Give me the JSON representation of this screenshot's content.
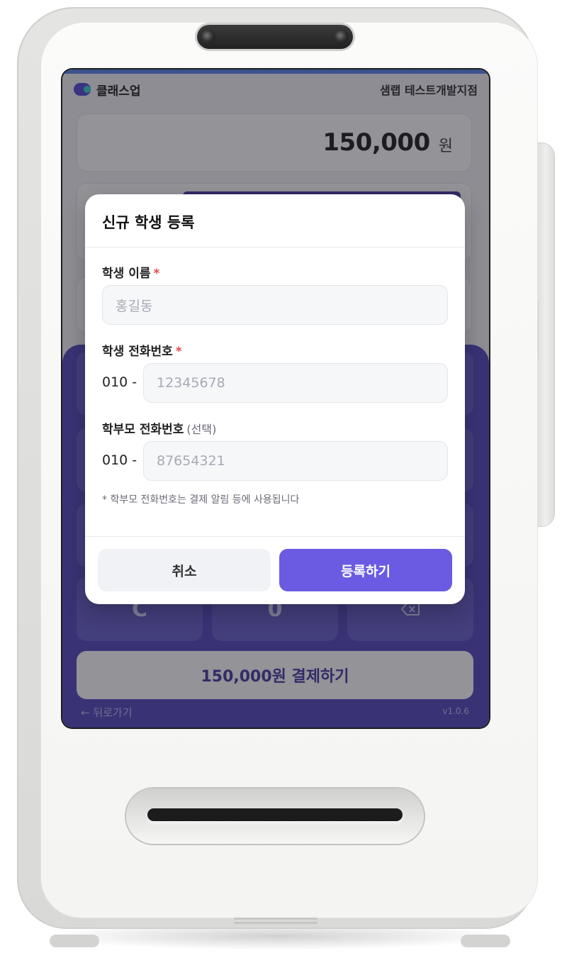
{
  "header": {
    "brand_name": "클래스업",
    "branch_name": "샘랩 테스트개발지점"
  },
  "payment": {
    "amount": "150,000",
    "unit": "원",
    "pay_button_label": "150,000원 결제하기"
  },
  "keypad": {
    "clear_label": "C",
    "zero_label": "0",
    "backspace_icon": "backspace-icon"
  },
  "footer": {
    "back_label": "← 뒤로가기",
    "version": "v1.0.6"
  },
  "modal": {
    "title": "신규 학생 등록",
    "student_name": {
      "label": "학생 이름",
      "required_mark": "*",
      "placeholder": "홍길동"
    },
    "student_phone": {
      "label": "학생 전화번호",
      "required_mark": "*",
      "prefix": "010 -",
      "placeholder": "12345678"
    },
    "parent_phone": {
      "label": "학부모 전화번호",
      "optional_text": "(선택)",
      "prefix": "010 -",
      "placeholder": "87654321"
    },
    "hint": "* 학부모 전화번호는 결제 알림 등에 사용됩니다",
    "cancel_label": "취소",
    "submit_label": "등록하기"
  },
  "colors": {
    "accent": "#6a5be2",
    "keypad_bg": "#4a3fb8",
    "required": "#e5484d"
  }
}
